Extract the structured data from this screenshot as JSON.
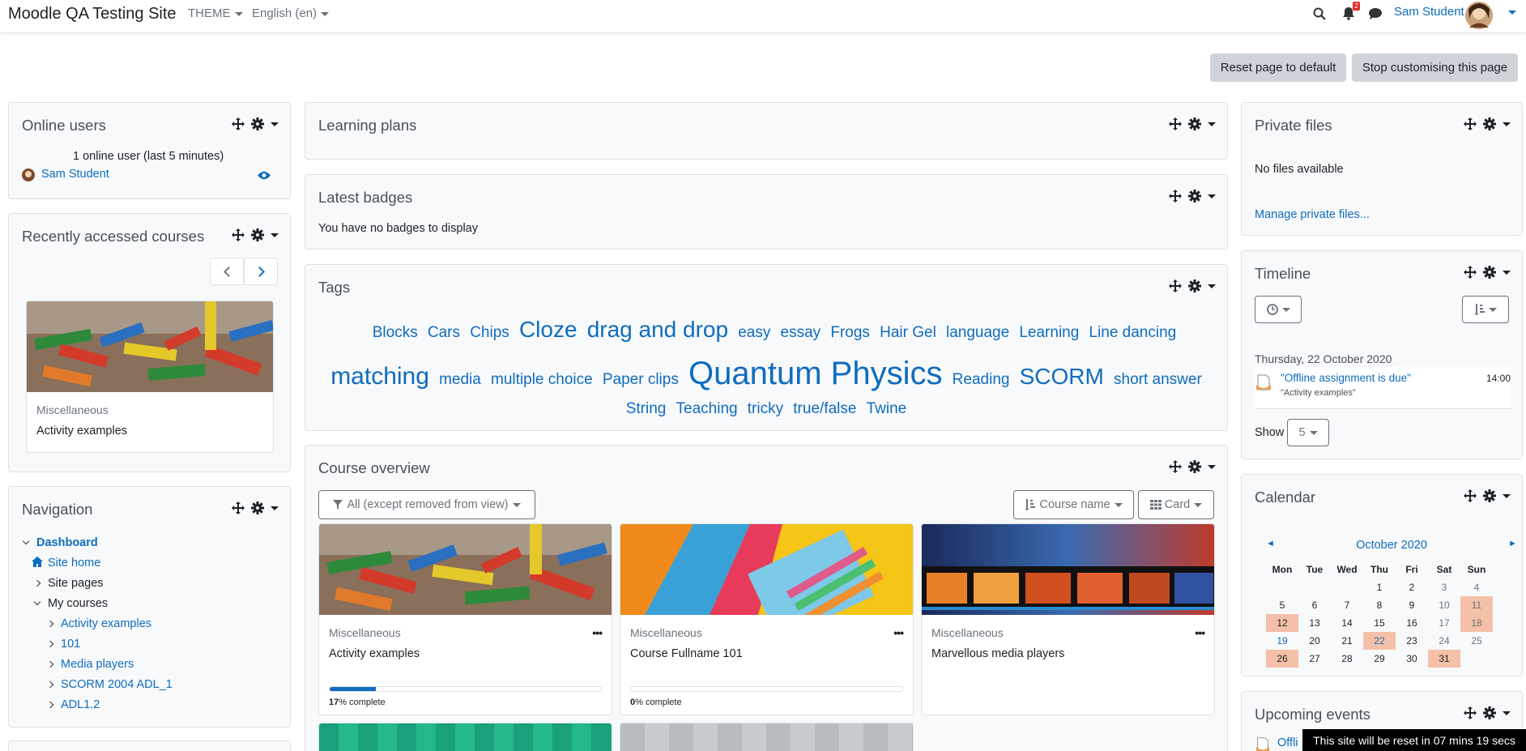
{
  "navbar": {
    "site_name": "Moodle QA Testing Site",
    "theme_label": "THEME",
    "language_label": "English (en)",
    "notification_count": "2",
    "user_name": "Sam Student"
  },
  "page_buttons": {
    "reset": "Reset page to default",
    "stop": "Stop customising this page"
  },
  "online_users": {
    "title": "Online users",
    "summary": "1 online user (last 5 minutes)",
    "user": "Sam Student"
  },
  "recent_courses": {
    "title": "Recently accessed courses",
    "course_category": "Miscellaneous",
    "course_name": "Activity examples"
  },
  "navigation": {
    "title": "Navigation",
    "dashboard": "Dashboard",
    "site_home": "Site home",
    "site_pages": "Site pages",
    "my_courses": "My courses",
    "courses": [
      "Activity examples",
      "101",
      "Media players",
      "SCORM 2004 ADL_1",
      "ADL1.2"
    ]
  },
  "learning_plans": {
    "title": "Learning plans"
  },
  "latest_badges": {
    "title": "Latest badges",
    "message": "You have no badges to display"
  },
  "tags": {
    "title": "Tags",
    "items": [
      "Blocks",
      "Cars",
      "Chips",
      "Cloze",
      "drag and drop",
      "easy",
      "essay",
      "Frogs",
      "Hair Gel",
      "language",
      "Learning",
      "Line dancing",
      "matching",
      "media",
      "multiple choice",
      "Paper clips",
      "Quantum Physics",
      "Reading",
      "SCORM",
      "short answer",
      "String",
      "Teaching",
      "tricky",
      "true/false",
      "Twine"
    ]
  },
  "course_overview": {
    "title": "Course overview",
    "filter": "All (except removed from view)",
    "sort": "Course name",
    "view": "Card",
    "courses": [
      {
        "category": "Miscellaneous",
        "name": "Activity examples",
        "progress": 17,
        "progress_text": "% complete"
      },
      {
        "category": "Miscellaneous",
        "name": "Course Fullname 101",
        "progress": 0,
        "progress_text": "% complete"
      },
      {
        "category": "Miscellaneous",
        "name": "Marvellous media players"
      }
    ]
  },
  "private_files": {
    "title": "Private files",
    "message": "No files available",
    "manage_link": "Manage private files..."
  },
  "timeline": {
    "title": "Timeline",
    "date_heading": "Thursday, 22 October 2020",
    "event_name": "\"Offline assignment is due\"",
    "event_course": "\"Activity examples\"",
    "event_time": "14:00",
    "show_label": "Show",
    "show_value": "5"
  },
  "calendar": {
    "title": "Calendar",
    "month": "October 2020",
    "prev_icon": "◄",
    "next_icon": "►",
    "days": [
      "Mon",
      "Tue",
      "Wed",
      "Thu",
      "Fri",
      "Sat",
      "Sun"
    ]
  },
  "upcoming_events": {
    "title": "Upcoming events",
    "event_partial": "Offli"
  },
  "reset_notice": "This site will be reset in 07 mins 19 secs",
  "colors": {
    "link": "#0f6cbf",
    "event_highlight": "#f5c0a8",
    "badge": "#e12727"
  }
}
